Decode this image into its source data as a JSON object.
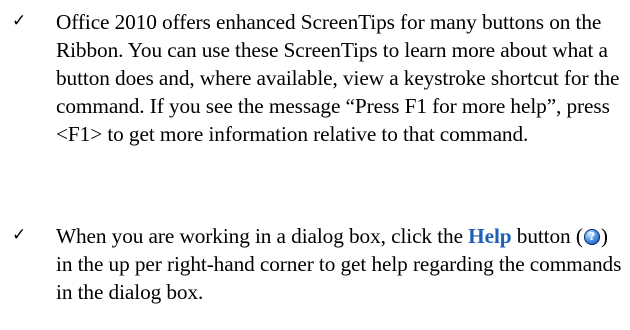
{
  "bullets": [
    {
      "marker": "✓",
      "text": "Office 2010 offers enhanced ScreenTips for many buttons on the Ribbon. You can use these ScreenTips to learn more about what a button does and, where available, view a keystroke shortcut for the command. If you see the message “Press F1 for more help”, press <F1> to get more information relative to that command."
    },
    {
      "marker": "✓",
      "text_before": "When you are working in a dialog box, click the ",
      "link": "Help",
      "text_mid": " button (",
      "icon": "help-icon",
      "text_after": ") in the up per right-hand corner to get help regarding the commands in the dialog box."
    }
  ]
}
